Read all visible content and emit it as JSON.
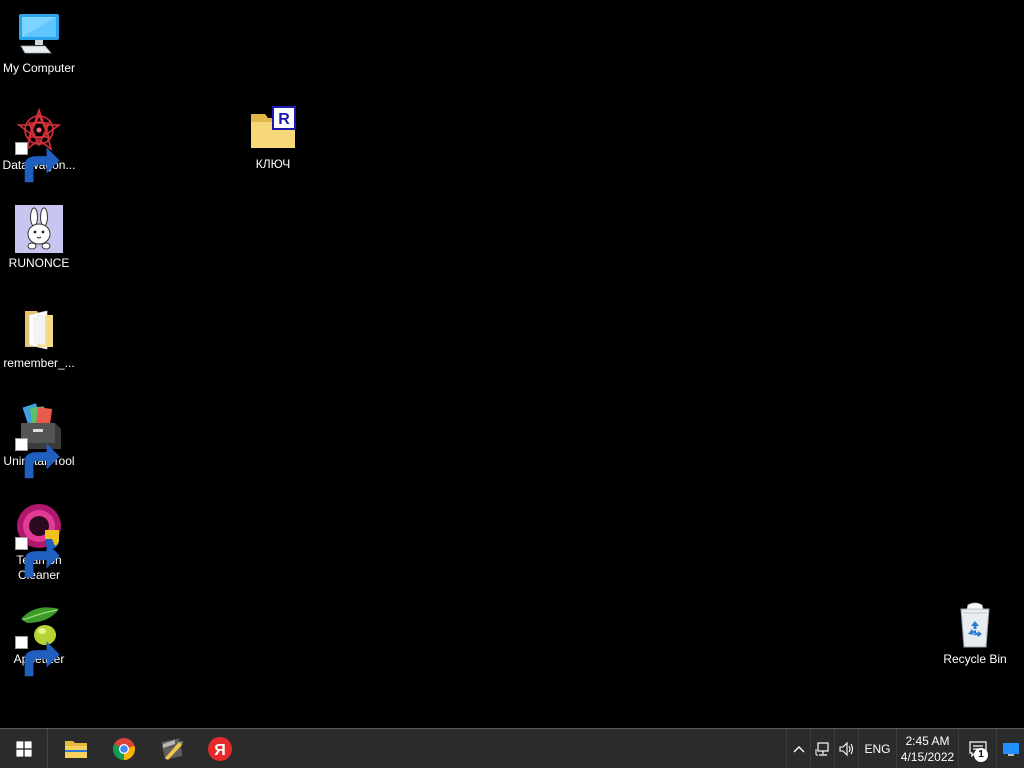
{
  "desktop": {
    "icons": [
      {
        "label": "My Computer"
      },
      {
        "label": "DataWagon..."
      },
      {
        "label": "RUNONCE"
      },
      {
        "label": "remember_..."
      },
      {
        "label": "Uninstall Tool"
      },
      {
        "label": "Telamon\nCleaner"
      },
      {
        "label": "Appetizer"
      },
      {
        "label": "КЛЮЧ"
      },
      {
        "label": "Recycle Bin"
      }
    ]
  },
  "taskbar": {
    "start_icon": "windows-logo-icon",
    "pinned": [
      "file-explorer-icon",
      "chrome-icon",
      "pen-tool-icon",
      "yandex-browser-icon"
    ],
    "tray": {
      "language": "ENG",
      "time": "2:45 AM",
      "date": "4/15/2022",
      "notification_count": "1"
    }
  },
  "colors": {
    "desktop_background": "#000000",
    "taskbar_background": "#2b2b2b",
    "accent": "#1e90ff"
  }
}
